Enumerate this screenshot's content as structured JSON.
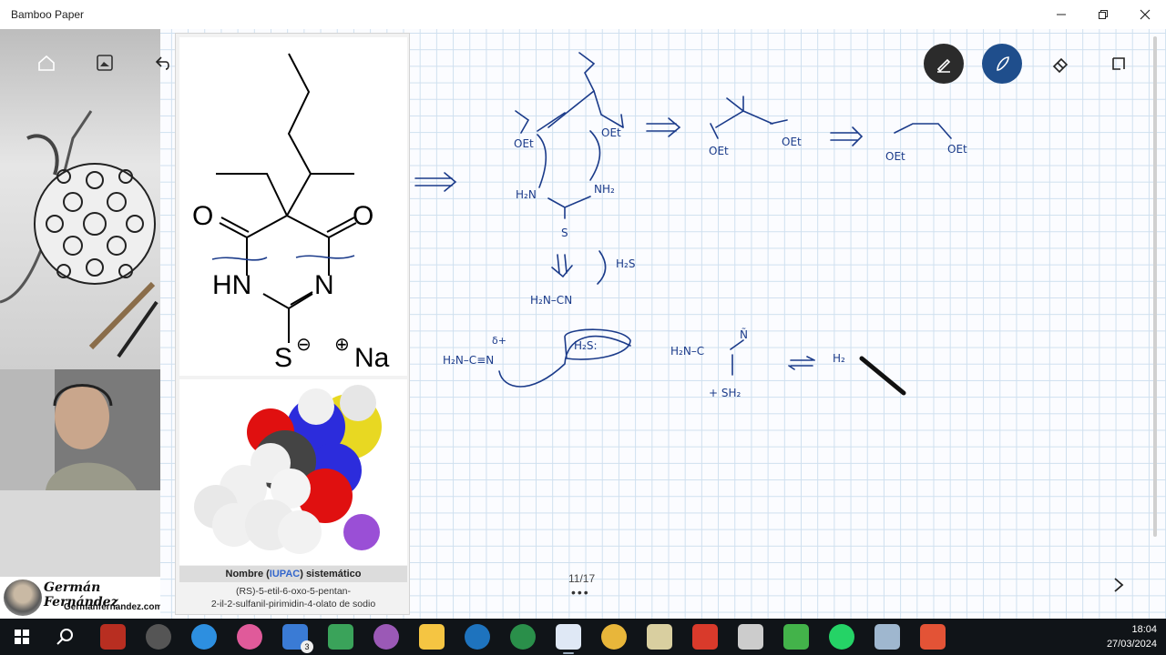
{
  "window": {
    "title": "Bamboo Paper",
    "controls": {
      "minimize": "minimize-icon",
      "restore": "restore-icon",
      "close": "close-icon"
    }
  },
  "toolbar_left": [
    "home-icon",
    "image-icon",
    "undo-icon",
    "redo-icon"
  ],
  "toolbar_right": [
    {
      "name": "pen-tool",
      "icon": "pen-icon",
      "bg": "#2b2b2b",
      "active": true
    },
    {
      "name": "brush-tool",
      "icon": "brush-icon",
      "bg": "#1f4e8c",
      "active": true
    },
    {
      "name": "eraser-tool",
      "icon": "eraser-icon",
      "bg": "transparent",
      "active": false
    },
    {
      "name": "lasso-tool",
      "icon": "lasso-icon",
      "bg": "transparent",
      "active": false
    }
  ],
  "molecule": {
    "atoms": {
      "o1": "O",
      "o2": "O",
      "hn": "HN",
      "n": "N",
      "s": "S",
      "s_charge": "⊖",
      "na_charge": "⊕",
      "na": "Na"
    },
    "caption_pre": "Nombre (",
    "caption_link": "IUPAC",
    "caption_post": ") sistemático",
    "systematic_name_1": "(RS)-5-etil-6-oxo-5-pentan-",
    "systematic_name_2": "2-il-2-sulfanil-pirimidin-4-olato de sodio"
  },
  "branding": {
    "name": "Germán Fernández",
    "site": "Germanfernandez.com"
  },
  "page": {
    "current": "11/17",
    "dots": "•••"
  },
  "colors": {
    "canvas": "#fbfcff",
    "grid": "#cfe0ef",
    "ink": "#1b3b8a",
    "taskbar": "#101418"
  },
  "taskbar": {
    "apps": [
      {
        "name": "start",
        "color": "#ffffff"
      },
      {
        "name": "search",
        "color": "#ffffff"
      },
      {
        "name": "filezilla",
        "color": "#b82e21"
      },
      {
        "name": "media-player",
        "color": "#8a8a8a"
      },
      {
        "name": "edge-app",
        "color": "#2d8fe0"
      },
      {
        "name": "paint-app",
        "color": "#e05a9a"
      },
      {
        "name": "mail-app",
        "color": "#3a7bd5"
      },
      {
        "name": "notepad-app",
        "color": "#3aa35a"
      },
      {
        "name": "3d-app",
        "color": "#9b59b6"
      },
      {
        "name": "explorer-app",
        "color": "#f5c542"
      },
      {
        "name": "globe-app",
        "color": "#1e73be"
      },
      {
        "name": "cd-app",
        "color": "#2a8f4a"
      },
      {
        "name": "bamboo-app",
        "color": "#dfe8f5"
      },
      {
        "name": "chrome-app",
        "color": "#e8b63a"
      },
      {
        "name": "txc-app",
        "color": "#d9cfa0"
      },
      {
        "name": "pdf-app",
        "color": "#d93a2b"
      },
      {
        "name": "inkscape-app",
        "color": "#cccccc"
      },
      {
        "name": "camtasia-app",
        "color": "#43b34a"
      },
      {
        "name": "whatsapp-app",
        "color": "#25d366"
      },
      {
        "name": "photos-app",
        "color": "#9fb7cf"
      },
      {
        "name": "recorder-app",
        "color": "#e35336"
      }
    ],
    "mail_badge": "3",
    "time": "18:04",
    "date": "27/03/2024"
  }
}
